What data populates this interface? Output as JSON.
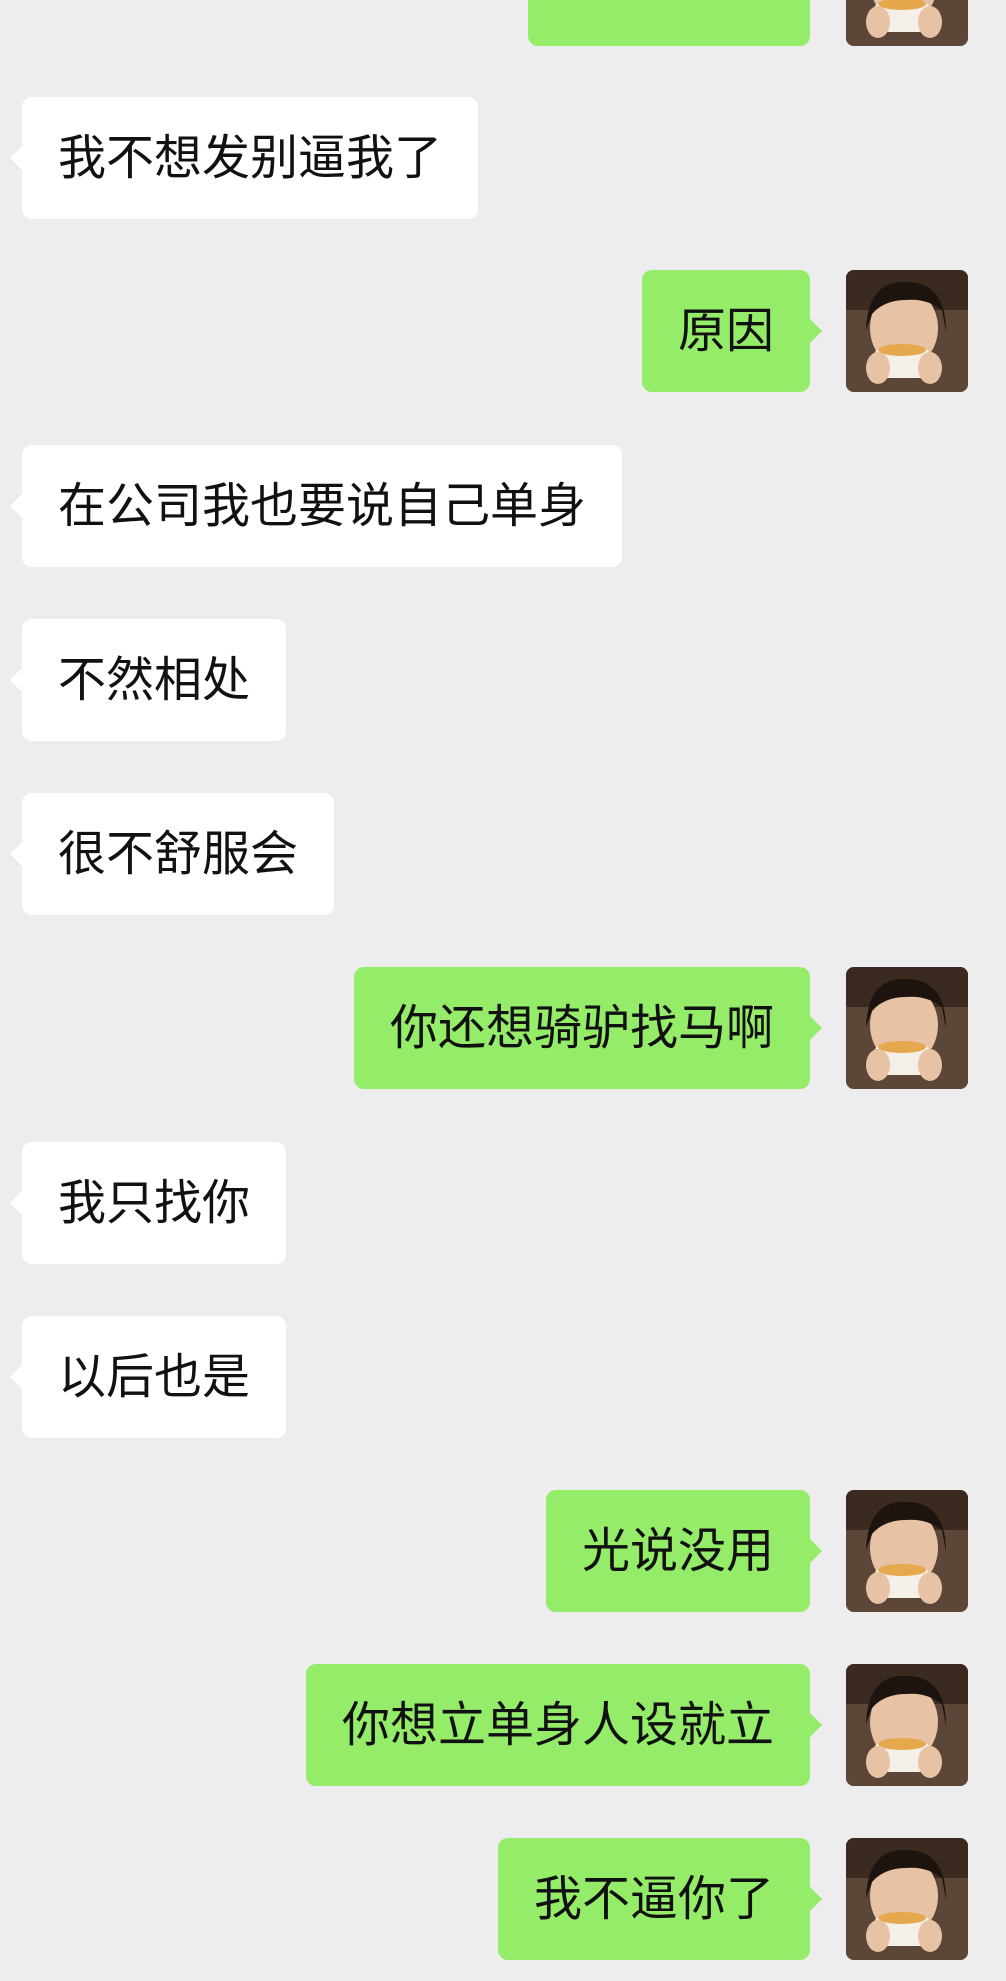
{
  "messages": [
    {
      "side": "left",
      "text": "我不想发别逼我了"
    },
    {
      "side": "right",
      "text": "原因"
    },
    {
      "side": "left",
      "text": "在公司我也要说自己单身"
    },
    {
      "side": "left",
      "text": "不然相处"
    },
    {
      "side": "left",
      "text": "很不舒服会"
    },
    {
      "side": "right",
      "text": "你还想骑驴找马啊"
    },
    {
      "side": "left",
      "text": "我只找你"
    },
    {
      "side": "left",
      "text": "以后也是"
    },
    {
      "side": "right",
      "text": "光说没用"
    },
    {
      "side": "right",
      "text": "你想立单身人设就立"
    },
    {
      "side": "right",
      "text": "我不逼你了"
    }
  ],
  "colors": {
    "background": "#ededed",
    "incoming_bubble": "#ffffff",
    "outgoing_bubble": "#95ec69",
    "text": "#111111"
  },
  "icons": {
    "user_avatar": "user-avatar-photo"
  }
}
